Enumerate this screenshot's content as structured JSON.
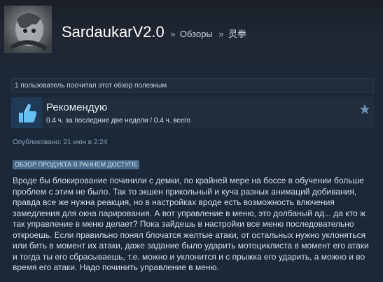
{
  "header": {
    "username": "SardaukarV2.0",
    "separator": "»",
    "crumb_reviews": "Обзоры",
    "crumb_game": "灵拳"
  },
  "helpful": {
    "text": "1 пользователь посчитал этот обзор полезным"
  },
  "recommendation": {
    "title": "Рекомендую",
    "hours": "0.4 ч. за последние две недели / 0.4 ч. всего",
    "icon": "thumbs-up-icon",
    "star_icon": "star-icon"
  },
  "published": "Опубликовано: 21 июн в 2:24",
  "early_access_label": "ОБЗОР ПРОДУКТА В РАННЕМ ДОСТУПЕ",
  "review_text": "Вроде бы блокирование починили с демки, по крайней мере на боссе в обучении больше проблем с этим не было. Так то экшен прикольный и куча разных анимаций добивания, правда все же нужна реакция, но в настройках вроде есть возможность влючения замедления для окна парирования. А вот управление в меню, это долбаный ад... да кто ж так управление в меню делает? Пока зайдешь в настройки все меню последовательно откроешь. Если правильно понял блочатся желтые атаки, от остальных нужно уклоняться или бить в момент их атаки, даже задание было ударить мотоциклиста в момент его атаки и тогда ты его сбрасываешь, т.е. можно и уклонится и с прыжка его ударить, а можно и во время его атаки. Надо починить управление в меню.",
  "colors": {
    "background": "#1b2838",
    "accent": "#66c0f4",
    "early_access_bg": "#4a6a8b"
  }
}
